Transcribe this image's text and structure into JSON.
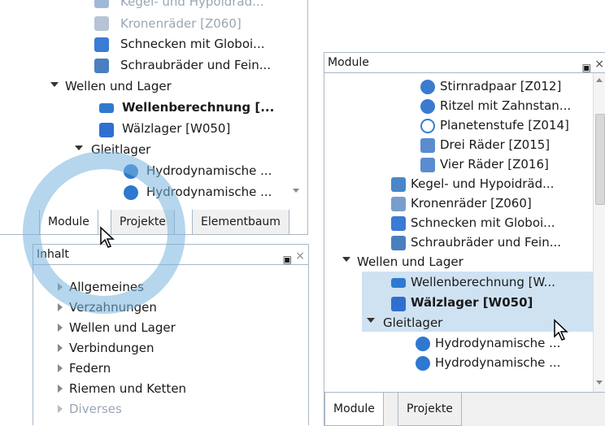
{
  "left_tree": {
    "items": [
      {
        "label": "Kegel- und Hypoidräd...",
        "faded": true
      },
      {
        "label": "Kronenräder [Z060]"
      },
      {
        "label": "Schnecken mit Globoi..."
      },
      {
        "label": "Schraubräder und Fein..."
      },
      {
        "label": "Wellen und Lager"
      },
      {
        "label": "Wellenberechnung [..."
      },
      {
        "label": "Wälzlager [W050]"
      },
      {
        "label": "Gleitlager"
      },
      {
        "label": "Hydrodynamische ..."
      },
      {
        "label": "Hydrodynamische ..."
      }
    ],
    "tabs": [
      "Module",
      "Projekte",
      "Elementbaum"
    ]
  },
  "inhalt": {
    "title": "Inhalt",
    "items": [
      "Allgemeines",
      "Verzahnungen",
      "Wellen und Lager",
      "Verbindungen",
      "Federn",
      "Riemen und Ketten",
      "Diverses"
    ]
  },
  "right_panel": {
    "title": "Module",
    "items": [
      {
        "label": "Stirnradpaar [Z012]"
      },
      {
        "label": "Ritzel mit Zahnstan..."
      },
      {
        "label": "Planetenstufe [Z014]"
      },
      {
        "label": "Drei Räder [Z015]"
      },
      {
        "label": "Vier Räder [Z016]"
      },
      {
        "label": "Kegel- und Hypoidräd..."
      },
      {
        "label": "Kronenräder [Z060]"
      },
      {
        "label": "Schnecken mit Globoi..."
      },
      {
        "label": "Schraubräder und Fein..."
      },
      {
        "label": "Wellen und Lager"
      },
      {
        "label": "Wellenberechnung [W..."
      },
      {
        "label": "Wälzlager [W050]"
      },
      {
        "label": "Gleitlager"
      },
      {
        "label": "Hydrodynamische ..."
      },
      {
        "label": "Hydrodynamische ..."
      }
    ],
    "tabs": [
      "Module",
      "Projekte"
    ],
    "highlight_color": "#cfe2f2"
  },
  "colors": {
    "accent": "#7fb6dd",
    "border": "#a9b7c9"
  }
}
